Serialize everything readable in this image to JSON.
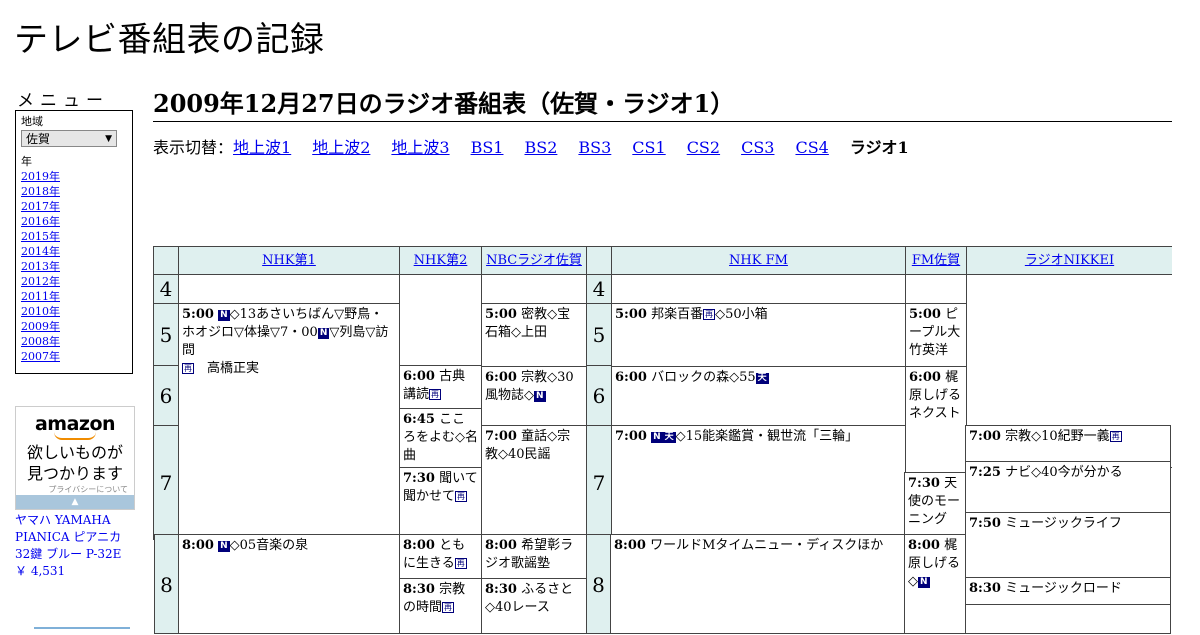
{
  "site_title": "テレビ番組表の記録",
  "menu": {
    "heading": "メニュー",
    "region_label": "地域",
    "region_value": "佐賀",
    "year_label": "年",
    "years": [
      "2019年",
      "2018年",
      "2017年",
      "2016年",
      "2015年",
      "2014年",
      "2013年",
      "2012年",
      "2011年",
      "2010年",
      "2009年",
      "2008年",
      "2007年"
    ]
  },
  "ad": {
    "logo": "amazon",
    "text_line1": "欲しいものが",
    "text_line2": "見つかります",
    "privacy": "プライバシーについて",
    "product_name": "ヤマハ YAMAHA PIANICA ピアニカ 32鍵 ブルー P-32E",
    "product_price": "￥ 4,531"
  },
  "heading": "2009年12月27日のラジオ番組表（佐賀・ラジオ1）",
  "switcher": {
    "label": "表示切替：",
    "links": [
      "地上波1",
      "地上波2",
      "地上波3",
      "BS1",
      "BS2",
      "BS3",
      "CS1",
      "CS2",
      "CS3",
      "CS4"
    ],
    "current": "ラジオ1"
  },
  "channels": [
    "NHK第1",
    "NHK第2",
    "NBCラジオ佐賀",
    "NHK FM",
    "FM佐賀",
    "ラジオNIKKEI"
  ],
  "hours": [
    "4",
    "5",
    "6",
    "7",
    "8"
  ],
  "programs": {
    "nhk1_5": {
      "time": "5:00",
      "a": "◇13あさいちばん▽野鳥・ホオジロ▽体操▽7・00",
      "b": "▽列島▽訪問",
      "c": "高橋正実"
    },
    "nhk1_8": {
      "time": "8:00",
      "a": "◇05音楽の泉"
    },
    "nhk2_600": {
      "time": "6:00",
      "a": "古典講読"
    },
    "nhk2_645": {
      "time": "6:45",
      "a": "こころをよむ◇名曲"
    },
    "nhk2_730": {
      "time": "7:30",
      "a": "聞いて聞かせて"
    },
    "nhk2_800": {
      "time": "8:00",
      "a": "ともに生きる"
    },
    "nhk2_830": {
      "time": "8:30",
      "a": "宗教の時間"
    },
    "nbc_500": {
      "time": "5:00",
      "a": "密教◇宝石箱◇上田"
    },
    "nbc_600": {
      "time": "6:00",
      "a": "宗教◇30風物誌◇"
    },
    "nbc_700": {
      "time": "7:00",
      "a": "童話◇宗教◇40民謡"
    },
    "nbc_800": {
      "time": "8:00",
      "a": "希望彰ラジオ歌謡塾"
    },
    "nbc_830": {
      "time": "8:30",
      "a": "ふるさと◇40レース"
    },
    "fm_500": {
      "time": "5:00",
      "a": "邦楽百番",
      "b": "◇50小箱"
    },
    "fm_600": {
      "time": "6:00",
      "a": "バロックの森◇55"
    },
    "fm_700": {
      "time": "7:00",
      "a": "◇15能楽鑑賞・観世流「三輪」"
    },
    "fm_800": {
      "time": "8:00",
      "a": "ワールドMタイムニュー・ディスクほか"
    },
    "fmsaga_500": {
      "time": "5:00",
      "a": "ピープル大竹英洋"
    },
    "fmsaga_600": {
      "time": "6:00",
      "a": "梶原しげるネクスト"
    },
    "fmsaga_730": {
      "time": "7:30",
      "a": "天使のモーニング"
    },
    "fmsaga_800": {
      "time": "8:00",
      "a": "梶原しげる◇"
    },
    "nikkei_700": {
      "time": "7:00",
      "a": "宗教◇10紀野一義"
    },
    "nikkei_725": {
      "time": "7:25",
      "a": "ナビ◇40今が分かる"
    },
    "nikkei_750": {
      "time": "7:50",
      "a": "ミュージックライフ"
    },
    "nikkei_830": {
      "time": "8:30",
      "a": "ミュージックロード"
    }
  },
  "icons": {
    "news": "N",
    "weather": "天",
    "stereo": "再"
  }
}
